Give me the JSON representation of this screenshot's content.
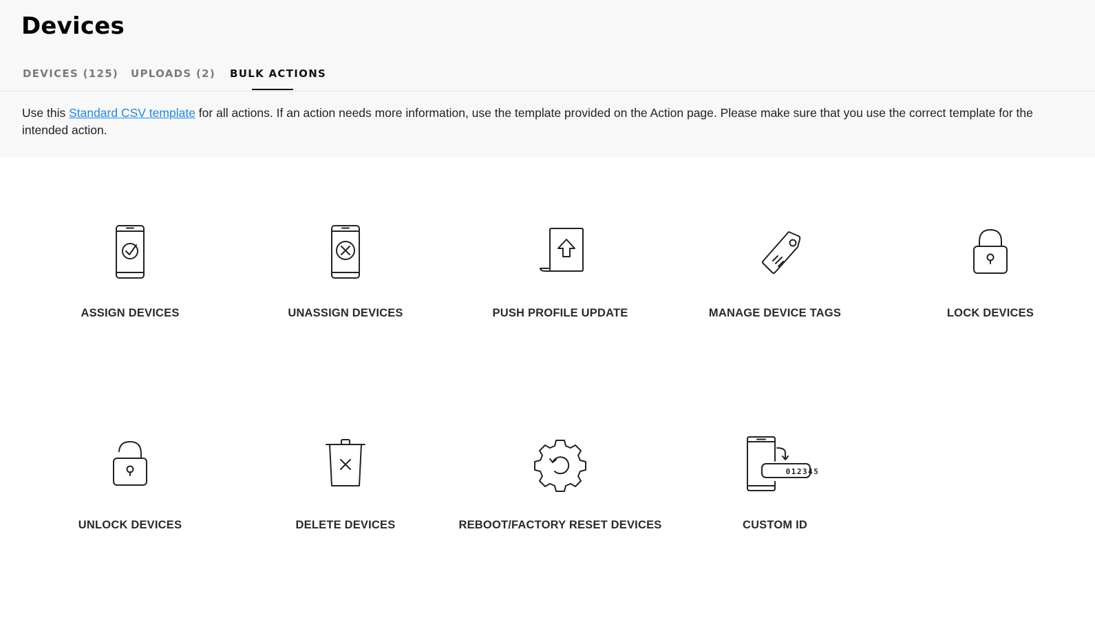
{
  "page": {
    "title": "Devices"
  },
  "tabs": [
    {
      "label": "DEVICES (125)",
      "active": false
    },
    {
      "label": "UPLOADS (2)",
      "active": false
    },
    {
      "label": "BULK ACTIONS",
      "active": true
    }
  ],
  "info": {
    "prefix": "Use this ",
    "link_text": "Standard CSV template",
    "suffix": " for all actions. If an action needs more information, use the template provided on the Action page. Please make sure that you use the correct template for the intended action."
  },
  "actions": [
    {
      "label": "ASSIGN DEVICES",
      "icon": "phone-check-icon"
    },
    {
      "label": "UNASSIGN DEVICES",
      "icon": "phone-x-icon"
    },
    {
      "label": "PUSH PROFILE UPDATE",
      "icon": "profile-upload-icon"
    },
    {
      "label": "MANAGE DEVICE TAGS",
      "icon": "tag-icon"
    },
    {
      "label": "LOCK DEVICES",
      "icon": "lock-icon"
    },
    {
      "label": "UNLOCK DEVICES",
      "icon": "unlock-icon"
    },
    {
      "label": "DELETE DEVICES",
      "icon": "trash-icon"
    },
    {
      "label": "REBOOT/FACTORY RESET DEVICES",
      "icon": "reboot-gear-icon"
    },
    {
      "label": "CUSTOM ID",
      "icon": "custom-id-icon",
      "badge_text": "012345"
    }
  ],
  "colors": {
    "link": "#1e88e5",
    "header_bg": "#f8f8f8",
    "active_tab": "#111111",
    "inactive_tab": "#7a7a7a"
  }
}
